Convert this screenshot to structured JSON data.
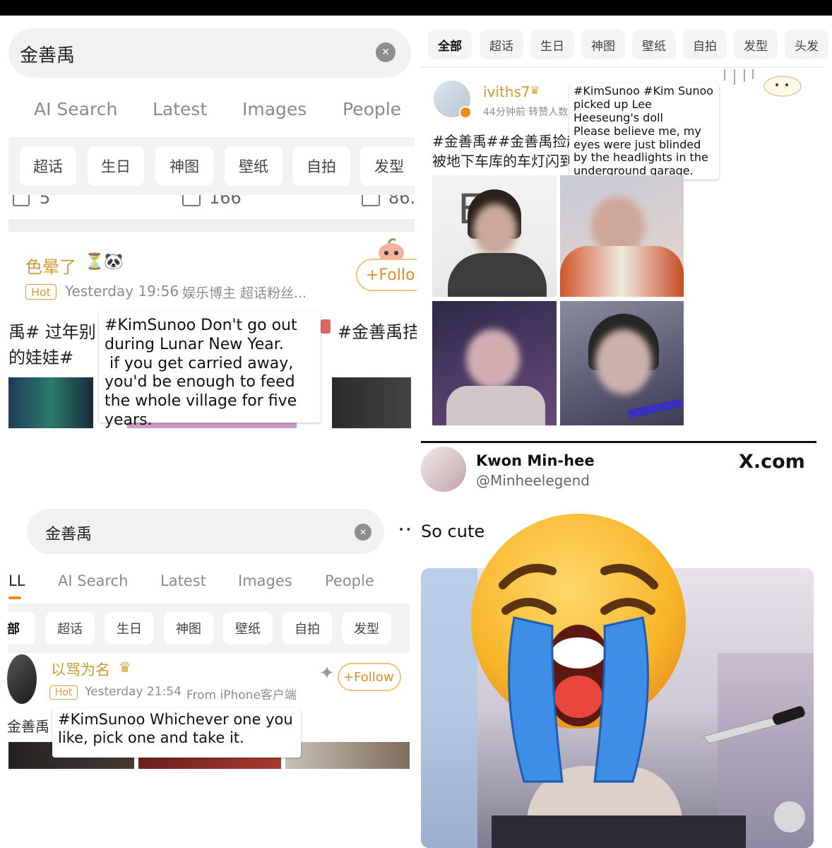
{
  "p1": {
    "search_query": "金善禹",
    "clear_icon": "✕",
    "tabs": [
      "AI Search",
      "Latest",
      "Images",
      "People"
    ],
    "chips": [
      "超话",
      "生日",
      "神图",
      "壁纸",
      "自拍",
      "发型"
    ],
    "counts": [
      "5",
      "166",
      "86."
    ],
    "post": {
      "username": "色晕了",
      "emoji_suffix": "⏳🐼",
      "badge": "Hot",
      "time": "Yesterday 19:56",
      "source": "娱乐博主 超话粉丝...",
      "follow": "+Follo",
      "line1_left": "禹# 过年别",
      "line1_right": "#金善禹拮",
      "line2_left": "的娃娃#",
      "caption": "#KimSunoo Don't go out during Lunar New Year.\n if you get carried away, you'd be enough to feed the whole village for five years."
    }
  },
  "p2": {
    "chips": [
      "全部",
      "超话",
      "生日",
      "神图",
      "壁纸",
      "自拍",
      "发型",
      "头发"
    ],
    "post": {
      "username": "iviths7",
      "meta": "44分钟前 转赞人数",
      "line1": "#金善禹##金善禹捡起",
      "line2": "被地下车库的车灯闪到",
      "caption": "#KimSunoo #Kim Sunoo picked up Lee Heeseung's doll\nPlease believe me, my eyes were just blinded by the headlights in the underground garage.",
      "image_text": "EA"
    }
  },
  "p3": {
    "search_query": "金善禹",
    "clear_icon": "✕",
    "tabs": [
      "LL",
      "AI Search",
      "Latest",
      "Images",
      "People"
    ],
    "chips": [
      "部",
      "超话",
      "生日",
      "神图",
      "壁纸",
      "自拍",
      "发型"
    ],
    "post": {
      "username": "以骂为名",
      "badge": "Hot",
      "time": "Yesterday 21:54",
      "source": "From iPhone客户端",
      "follow": "+Follow",
      "line_left": "金善禹",
      "caption": "#KimSunoo Whichever one you like, pick one and take it."
    }
  },
  "p4": {
    "name": "Kwon Min-hee",
    "handle": "@Minheelegend",
    "brand": "X.com",
    "text": "So cute",
    "dots": "••"
  },
  "colors": {
    "gold": "#d09a34",
    "hot": "#e49a3c",
    "follow": "#e08e28",
    "chip_bg": "#f2f2f2"
  },
  "icons": [
    "clear-icon",
    "crown-icon",
    "verified-icon",
    "hourglass-icon",
    "panda-icon",
    "sparkle-icon",
    "crying-face-emoji",
    "knife-icon",
    "x-logo"
  ]
}
